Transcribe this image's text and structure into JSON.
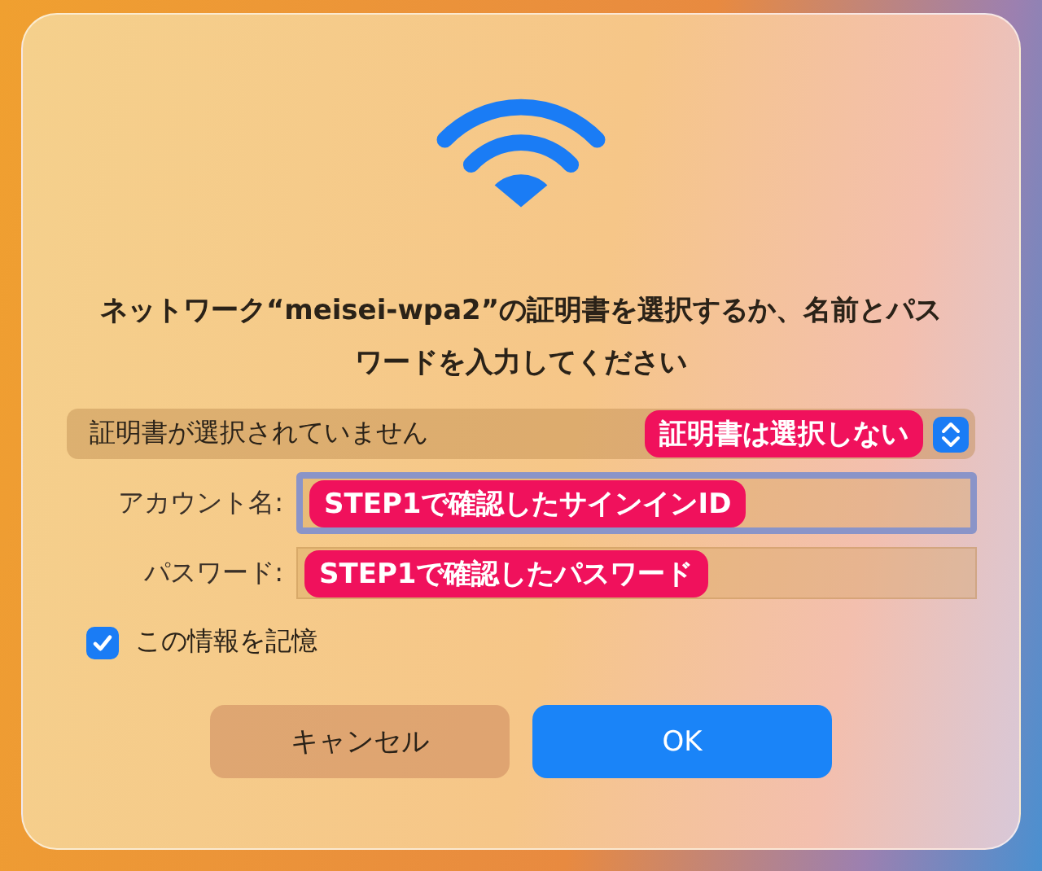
{
  "dialog": {
    "message": "ネットワーク“meisei-wpa2”の証明書を選択するか、名前とパスワードを入力してください",
    "certificate_popup": {
      "value": "証明書が選択されていません",
      "annotation": "証明書は選択しない"
    },
    "fields": [
      {
        "label": "アカウント名:",
        "focused": true,
        "annotation": "STEP1で確認したサインインID"
      },
      {
        "label": "パスワード:",
        "focused": false,
        "annotation": "STEP1で確認したパスワード"
      }
    ],
    "remember": {
      "label": "この情報を記憶",
      "checked": true
    },
    "buttons": [
      {
        "label": "キャンセル",
        "kind": "secondary"
      },
      {
        "label": "OK",
        "kind": "primary"
      }
    ]
  }
}
